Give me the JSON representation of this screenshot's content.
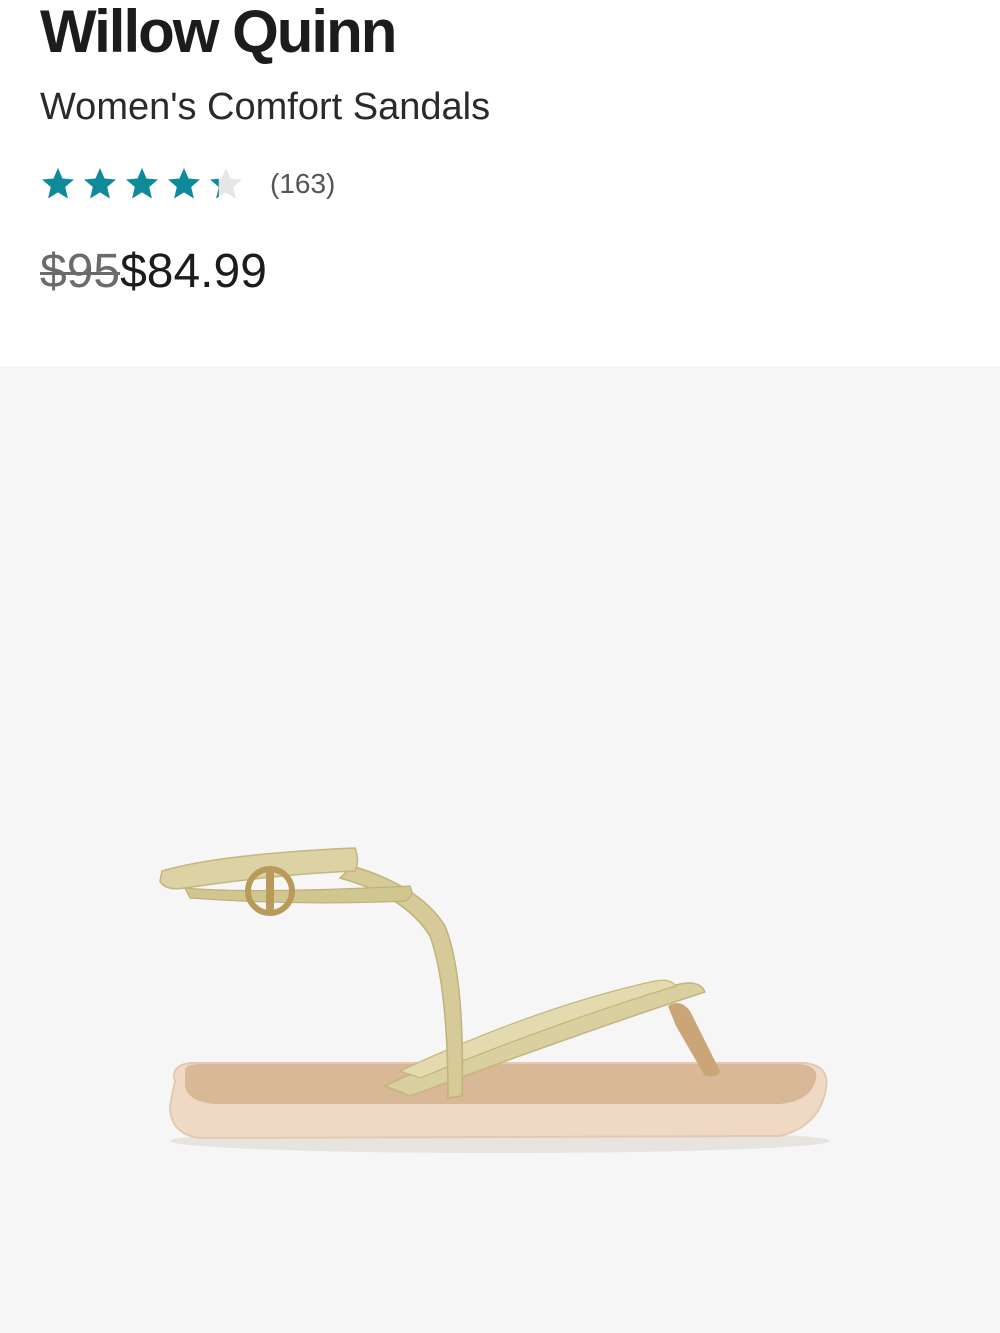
{
  "product": {
    "brand": "Willow Quinn",
    "name": "Women's Comfort Sandals",
    "rating": {
      "value": 4.3,
      "max": 5,
      "count_label": "(163)",
      "filled_color": "#0e8a9a",
      "empty_color": "#e6e6e6"
    },
    "price": {
      "original": "$95",
      "sale": "$84.99"
    }
  },
  "image": {
    "icon": "sandal-product-photo",
    "background": "#f6f6f6",
    "colors": {
      "strap": "#d9cf9f",
      "footbed": "#d8b896",
      "sole": "#efd9c4"
    }
  }
}
